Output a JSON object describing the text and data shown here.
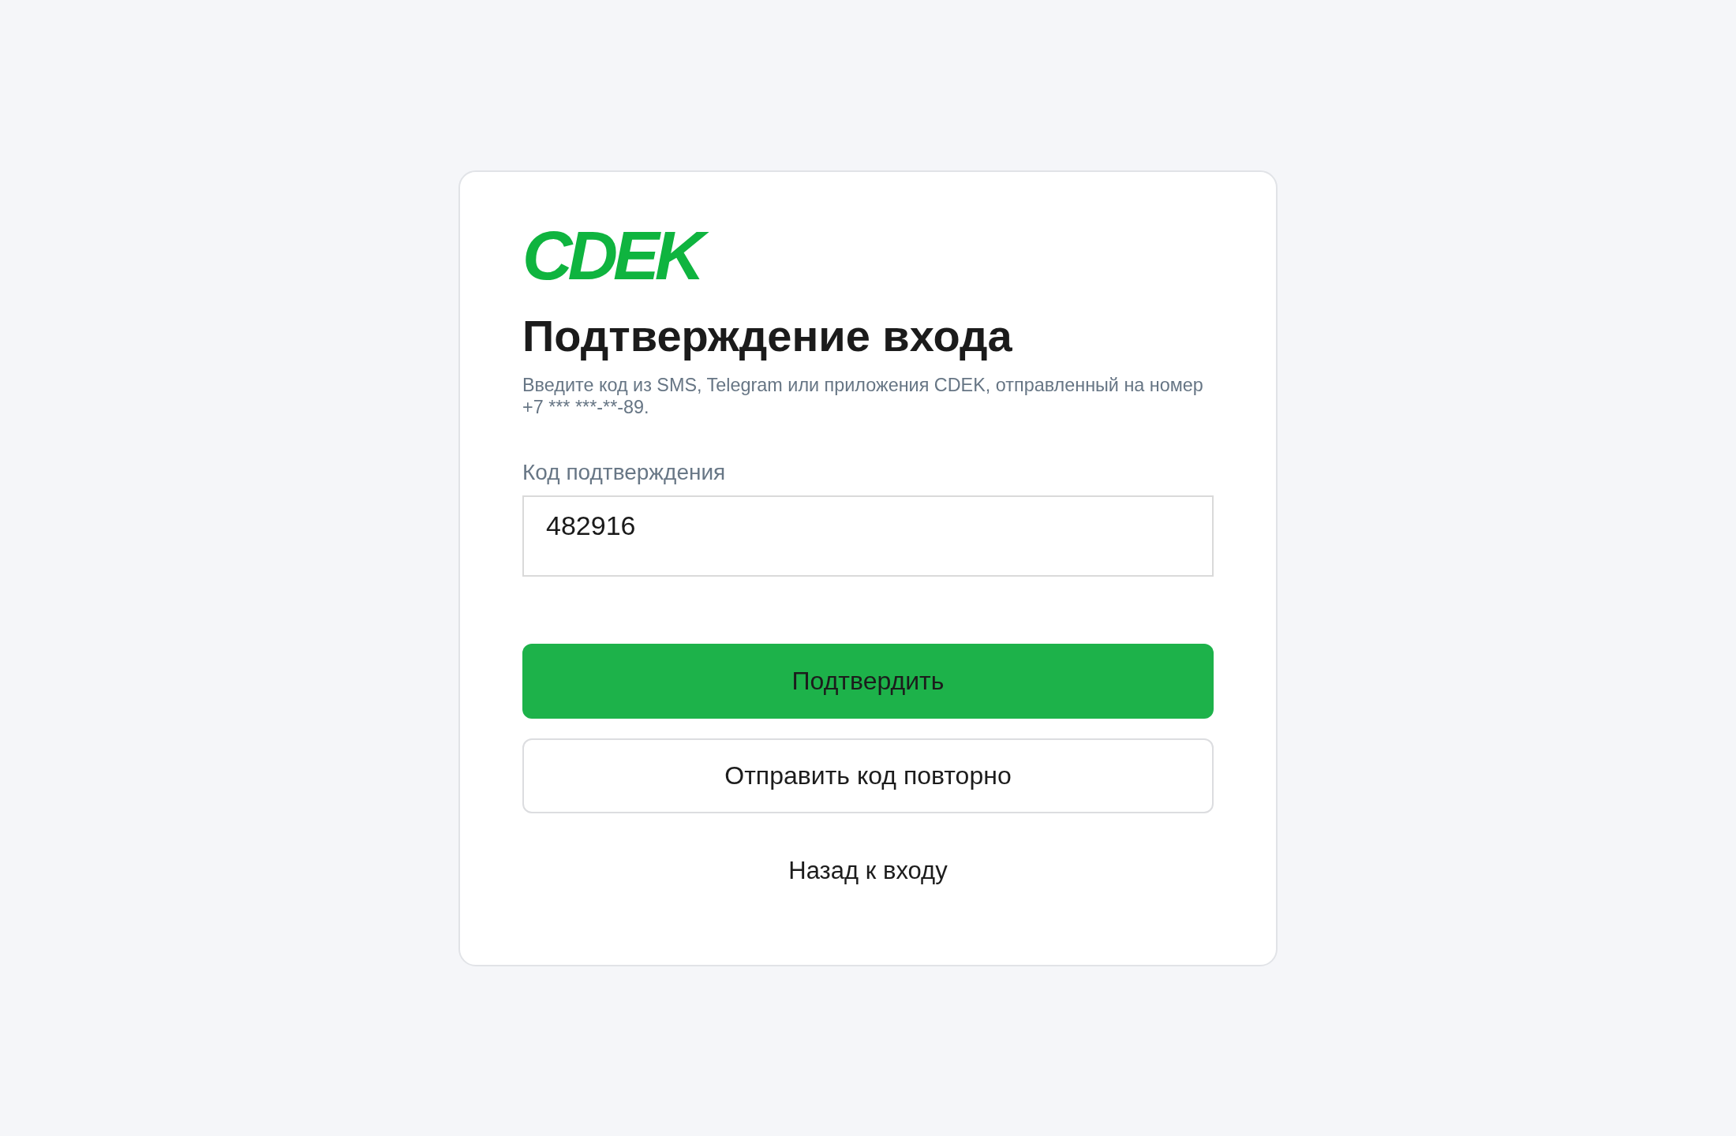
{
  "logo": {
    "text": "CDEK"
  },
  "title": "Подтверждение входа",
  "subtitle": "Введите код из SMS, Telegram или приложения CDEK, отправленный на номер +7 *** ***-**-89.",
  "code_field": {
    "label": "Код подтверждения",
    "value": "482916"
  },
  "buttons": [
    {
      "label": "Подтвердить",
      "kind": "primary"
    },
    {
      "label": "Отправить код повторно",
      "kind": "secondary"
    }
  ],
  "back_link": "Назад к входу"
}
